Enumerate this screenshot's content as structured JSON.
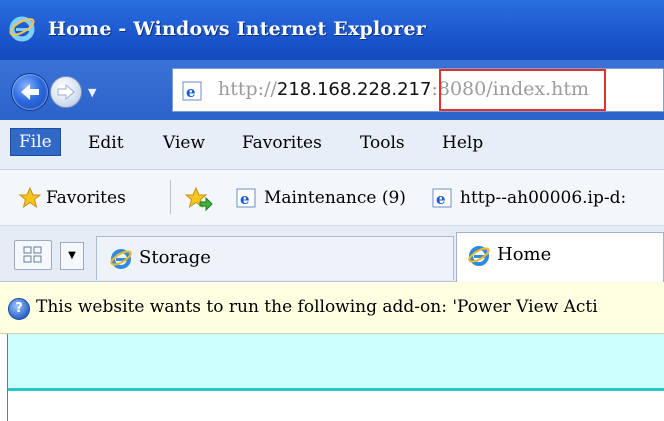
{
  "window": {
    "title": "Home - Windows Internet Explorer"
  },
  "address_bar": {
    "url_scheme": "http://",
    "url_host": "218.168.228.217",
    "url_rest": ":8080/index.htm"
  },
  "menu": {
    "items": [
      "File",
      "Edit",
      "View",
      "Favorites",
      "Tools",
      "Help"
    ]
  },
  "favorites_bar": {
    "favorites_label": "Favorites",
    "links": [
      "Maintenance (9)",
      "http--ah00006.ip-d:"
    ]
  },
  "tabs": [
    {
      "label": "Storage",
      "active": false
    },
    {
      "label": "Home",
      "active": true
    }
  ],
  "info_bar": {
    "message": "This website wants to run the following add-on: 'Power View Acti"
  },
  "colors": {
    "title_bar": "#1c58cf",
    "highlight_box": "#e03030",
    "info_bar": "#ffffe1",
    "content_bg": "#ccffff",
    "content_line": "#2dc6c6"
  },
  "icons": {
    "app": "ie-icon",
    "back": "back-arrow-icon",
    "forward": "forward-arrow-icon",
    "favorites": "star-icon",
    "add_favorites": "add-favorites-icon",
    "quick_tabs": "quick-tabs-icon",
    "info": "info-shield-icon"
  }
}
